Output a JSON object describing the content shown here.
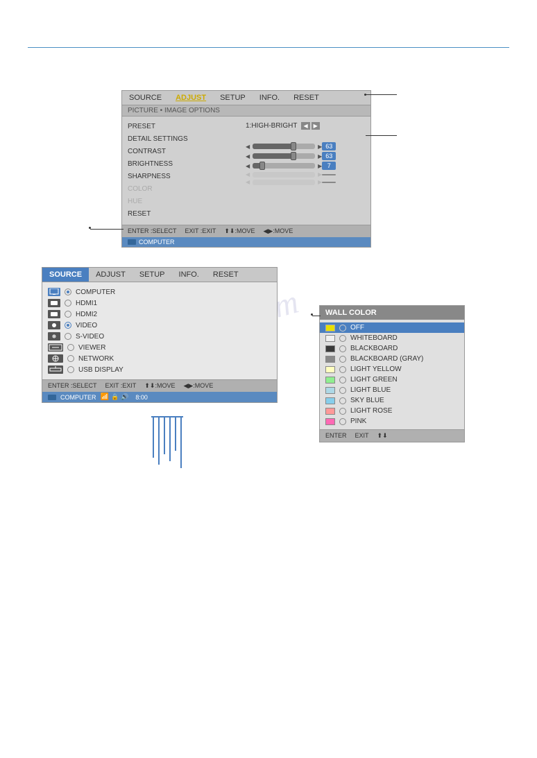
{
  "topLine": {},
  "watermark": "manualshive.com",
  "upperPanel": {
    "menuItems": [
      "SOURCE",
      "ADJUST",
      "SETUP",
      "INFO.",
      "RESET"
    ],
    "activeMenu": "ADJUST",
    "subMenu": "PICTURE • IMAGE OPTIONS",
    "preset": {
      "label": "PRESET",
      "value": "1:HIGH-BRIGHT"
    },
    "rows": [
      {
        "label": "DETAIL SETTINGS"
      },
      {
        "label": "CONTRAST",
        "hasSlider": true,
        "fillPct": 65,
        "thumbPct": 65,
        "value": "63",
        "colored": true
      },
      {
        "label": "BRIGHTNESS",
        "hasSlider": true,
        "fillPct": 65,
        "thumbPct": 65,
        "value": "63",
        "colored": true
      },
      {
        "label": "SHARPNESS",
        "hasSlider": true,
        "fillPct": 10,
        "thumbPct": 10,
        "value": "7",
        "colored": true
      },
      {
        "label": "COLOR",
        "hasSlider": true,
        "fillPct": 0,
        "thumbPct": 0,
        "value": "",
        "colored": false
      },
      {
        "label": "HUE",
        "hasSlider": true,
        "fillPct": 0,
        "thumbPct": 0,
        "value": "",
        "colored": false
      },
      {
        "label": "RESET"
      }
    ],
    "bottomBar": [
      "ENTER :SELECT",
      "EXIT :EXIT",
      "⬆⬇:MOVE",
      "◀▶:MOVE"
    ],
    "statusBar": "COMPUTER"
  },
  "lowerLeftPanel": {
    "menuItems": [
      "SOURCE",
      "ADJUST",
      "SETUP",
      "INFO.",
      "RESET"
    ],
    "activeMenu": "SOURCE",
    "sources": [
      {
        "icon": "monitor",
        "selected": true,
        "label": "COMPUTER"
      },
      {
        "icon": "hdmi",
        "selected": false,
        "label": "HDMI1"
      },
      {
        "icon": "hdmi",
        "selected": false,
        "label": "HDMI2"
      },
      {
        "icon": "video",
        "selected": false,
        "label": "VIDEO"
      },
      {
        "icon": "svideo",
        "selected": false,
        "label": "S-VIDEO"
      },
      {
        "icon": "viewer",
        "selected": false,
        "label": "VIEWER"
      },
      {
        "icon": "network",
        "selected": false,
        "label": "NETWORK"
      },
      {
        "icon": "usb",
        "selected": false,
        "label": "USB DISPLAY"
      }
    ],
    "bottomBar": [
      "ENTER :SELECT",
      "EXIT :EXIT",
      "⬆⬇:MOVE",
      "◀▶:MOVE"
    ],
    "statusBar": {
      "label": "COMPUTER",
      "time": "8:00"
    }
  },
  "lowerRightPanel": {
    "title": "WALL COLOR",
    "items": [
      {
        "label": "OFF",
        "color": "#e8e000",
        "selected": true
      },
      {
        "label": "WHITEBOARD",
        "color": "#f0f0f0"
      },
      {
        "label": "BLACKBOARD",
        "color": "#3a3a3a"
      },
      {
        "label": "BLACKBOARD (GRAY)",
        "color": "#888888"
      },
      {
        "label": "LIGHT YELLOW",
        "color": "#ffffc0"
      },
      {
        "label": "LIGHT GREEN",
        "color": "#90ee90"
      },
      {
        "label": "LIGHT BLUE",
        "color": "#add8e6"
      },
      {
        "label": "SKY BLUE",
        "color": "#87ceeb"
      },
      {
        "label": "LIGHT ROSE",
        "color": "#ff9999"
      },
      {
        "label": "PINK",
        "color": "#ff69b4"
      }
    ],
    "bottomBar": [
      "ENTER",
      "EXIT",
      "⬆⬇"
    ]
  }
}
